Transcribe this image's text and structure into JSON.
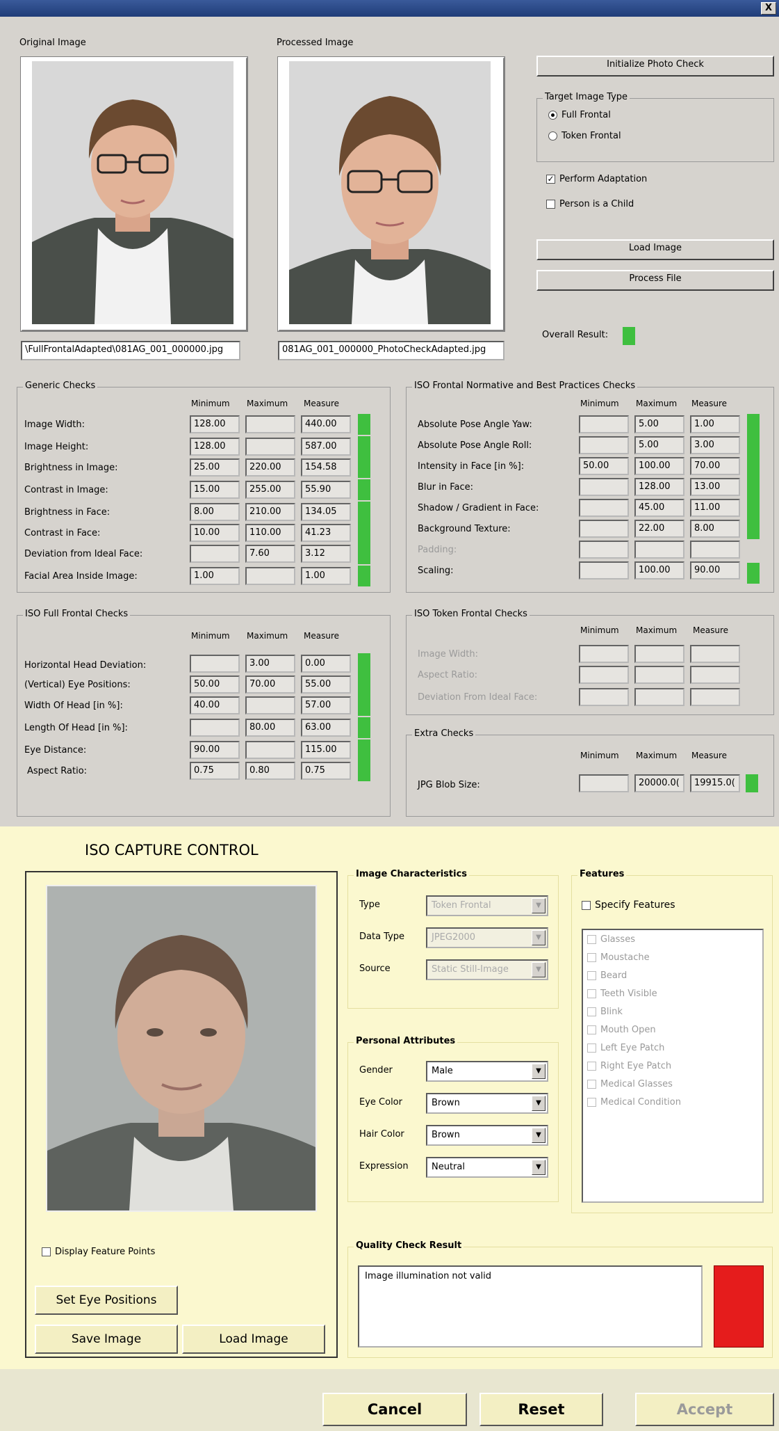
{
  "window": {
    "close_label": "X"
  },
  "photo_check": {
    "original_label": "Original Image",
    "processed_label": "Processed Image",
    "original_path": "\\FullFrontalAdapted\\081AG_001_000000.jpg",
    "processed_path": "081AG_001_000000_PhotoCheckAdapted.jpg",
    "initialize_button": "Initialize Photo Check",
    "target_type_title": "Target Image Type",
    "radio_full_frontal": "Full Frontal",
    "radio_token_frontal": "Token Frontal",
    "cb_perform_adaptation": "Perform Adaptation",
    "cb_person_child": "Person is a Child",
    "load_image_button": "Load Image",
    "process_file_button": "Process File",
    "overall_result_label": "Overall Result:",
    "indicator_green": "#3fbf3f"
  },
  "generic_checks": {
    "title": "Generic Checks",
    "headers": [
      "Minimum",
      "Maximum",
      "Measure"
    ],
    "rows": [
      {
        "label": "Image Width:",
        "min": "128.00",
        "max": "",
        "measure": "440.00"
      },
      {
        "label": "Image Height:",
        "min": "128.00",
        "max": "",
        "measure": "587.00"
      },
      {
        "label": "Brightness in Image:",
        "min": "25.00",
        "max": "220.00",
        "measure": "154.58"
      },
      {
        "label": "Contrast in Image:",
        "min": "15.00",
        "max": "255.00",
        "measure": "55.90"
      },
      {
        "label": "Brightness in Face:",
        "min": "8.00",
        "max": "210.00",
        "measure": "134.05"
      },
      {
        "label": "Contrast in Face:",
        "min": "10.00",
        "max": "110.00",
        "measure": "41.23"
      },
      {
        "label": "Deviation from Ideal Face:",
        "min": "",
        "max": "7.60",
        "measure": "3.12"
      },
      {
        "label": "Facial Area Inside Image:",
        "min": "1.00",
        "max": "",
        "measure": "1.00"
      }
    ]
  },
  "iso_normative": {
    "title": "ISO Frontal Normative and Best Practices Checks",
    "headers": [
      "Minimum",
      "Maximum",
      "Measure"
    ],
    "rows": [
      {
        "label": "Absolute Pose Angle Yaw:",
        "min": "",
        "max": "5.00",
        "measure": "1.00"
      },
      {
        "label": "Absolute Pose Angle Roll:",
        "min": "",
        "max": "5.00",
        "measure": "3.00"
      },
      {
        "label": "Intensity in Face [in %]:",
        "min": "50.00",
        "max": "100.00",
        "measure": "70.00"
      },
      {
        "label": "Blur in Face:",
        "min": "",
        "max": "128.00",
        "measure": "13.00"
      },
      {
        "label": "Shadow / Gradient in Face:",
        "min": "",
        "max": "45.00",
        "measure": "11.00"
      },
      {
        "label": "Background Texture:",
        "min": "",
        "max": "22.00",
        "measure": "8.00"
      },
      {
        "label": "Padding:",
        "min": "",
        "max": "",
        "measure": ""
      },
      {
        "label": "Scaling:",
        "min": "",
        "max": "100.00",
        "measure": "90.00"
      }
    ]
  },
  "iso_full_frontal": {
    "title": "ISO Full Frontal Checks",
    "headers": [
      "Minimum",
      "Maximum",
      "Measure"
    ],
    "rows": [
      {
        "label": "Horizontal Head Deviation:",
        "min": "",
        "max": "3.00",
        "measure": "0.00"
      },
      {
        "label": "(Vertical) Eye Positions:",
        "min": "50.00",
        "max": "70.00",
        "measure": "55.00"
      },
      {
        "label": "Width Of Head [in %]:",
        "min": "40.00",
        "max": "",
        "measure": "57.00"
      },
      {
        "label": "Length Of Head [in %]:",
        "min": "",
        "max": "80.00",
        "measure": "63.00"
      },
      {
        "label": "Eye Distance:",
        "min": "90.00",
        "max": "",
        "measure": "115.00"
      },
      {
        "label": "Aspect Ratio:",
        "min": "0.75",
        "max": "0.80",
        "measure": "0.75"
      }
    ]
  },
  "iso_token_frontal": {
    "title": "ISO Token Frontal Checks",
    "headers": [
      "Minimum",
      "Maximum",
      "Measure"
    ],
    "rows": [
      {
        "label": "Image Width:"
      },
      {
        "label": "Aspect Ratio:"
      },
      {
        "label": "Deviation From Ideal Face:"
      }
    ]
  },
  "extra_checks": {
    "title": "Extra Checks",
    "headers": [
      "Minimum",
      "Maximum",
      "Measure"
    ],
    "rows": [
      {
        "label": "JPG Blob Size:",
        "min": "",
        "max": "20000.0(",
        "measure": "19915.0("
      }
    ]
  },
  "capture": {
    "title": "ISO CAPTURE CONTROL",
    "display_feature_points": "Display Feature Points",
    "set_eye_positions": "Set Eye Positions",
    "save_image": "Save Image",
    "load_image": "Load Image",
    "image_characteristics": {
      "title": "Image Characteristics",
      "type_label": "Type",
      "type_value": "Token Frontal",
      "data_type_label": "Data Type",
      "data_type_value": "JPEG2000",
      "source_label": "Source",
      "source_value": "Static Still-Image"
    },
    "personal_attributes": {
      "title": "Personal Attributes",
      "gender_label": "Gender",
      "gender_value": "Male",
      "eye_color_label": "Eye Color",
      "eye_color_value": "Brown",
      "hair_color_label": "Hair Color",
      "hair_color_value": "Brown",
      "expression_label": "Expression",
      "expression_value": "Neutral"
    },
    "features": {
      "title": "Features",
      "specify_features": "Specify Features",
      "items": [
        "Glasses",
        "Moustache",
        "Beard",
        "Teeth Visible",
        "Blink",
        "Mouth Open",
        "Left Eye Patch",
        "Right Eye Patch",
        "Medical Glasses",
        "Medical Condition"
      ]
    },
    "quality": {
      "title": "Quality Check Result",
      "message": "Image illumination not valid",
      "status_color": "#e51c1c"
    }
  },
  "footer": {
    "cancel": "Cancel",
    "reset": "Reset",
    "accept": "Accept"
  }
}
